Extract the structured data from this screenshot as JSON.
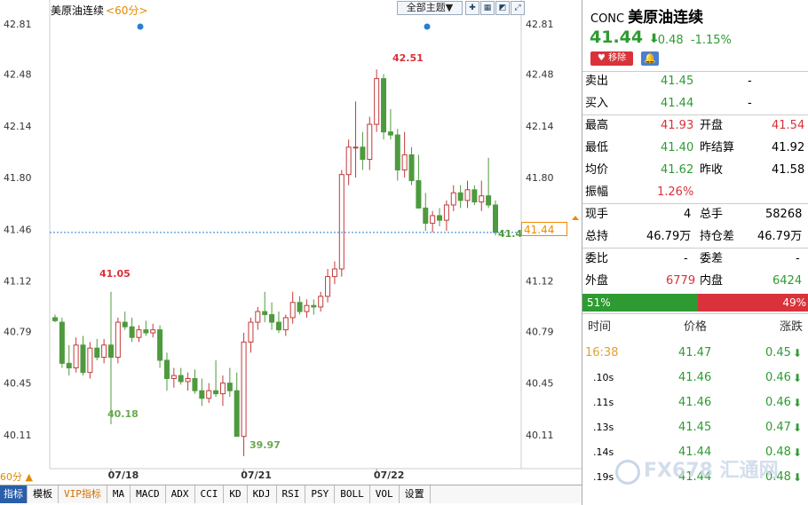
{
  "chart": {
    "title": "美原油连续",
    "period": "<60分>",
    "theme_button": "全部主题▼",
    "period_indicator": "60分 ▲",
    "current_price_tag": "41.44",
    "current_price_right_label": "41.4",
    "high_label": "42.51",
    "low_label": "39.97",
    "left_high_label": "41.05",
    "left_low_label": "40.18"
  },
  "chart_data": {
    "type": "candlestick",
    "title": "美原油连续",
    "y_ticks": [
      "42.81",
      "42.48",
      "42.14",
      "41.80",
      "41.46",
      "41.12",
      "40.79",
      "40.45",
      "40.11"
    ],
    "x_ticks": [
      "07/18",
      "07/21",
      "07/22"
    ],
    "ylim": [
      39.9,
      42.85
    ],
    "last_price": 41.44,
    "candles": [
      {
        "o": 40.88,
        "h": 40.9,
        "l": 40.85,
        "c": 40.86
      },
      {
        "o": 40.85,
        "h": 40.88,
        "l": 40.55,
        "c": 40.58
      },
      {
        "o": 40.58,
        "h": 40.7,
        "l": 40.5,
        "c": 40.55
      },
      {
        "o": 40.55,
        "h": 40.75,
        "l": 40.52,
        "c": 40.7
      },
      {
        "o": 40.7,
        "h": 40.76,
        "l": 40.5,
        "c": 40.52
      },
      {
        "o": 40.52,
        "h": 40.72,
        "l": 40.48,
        "c": 40.68
      },
      {
        "o": 40.68,
        "h": 40.74,
        "l": 40.6,
        "c": 40.62
      },
      {
        "o": 40.62,
        "h": 40.74,
        "l": 40.58,
        "c": 40.7
      },
      {
        "o": 40.7,
        "h": 41.05,
        "l": 40.18,
        "c": 40.62
      },
      {
        "o": 40.62,
        "h": 40.88,
        "l": 40.58,
        "c": 40.85
      },
      {
        "o": 40.85,
        "h": 40.92,
        "l": 40.8,
        "c": 40.82
      },
      {
        "o": 40.82,
        "h": 40.88,
        "l": 40.72,
        "c": 40.75
      },
      {
        "o": 40.75,
        "h": 40.83,
        "l": 40.72,
        "c": 40.8
      },
      {
        "o": 40.8,
        "h": 40.86,
        "l": 40.76,
        "c": 40.78
      },
      {
        "o": 40.78,
        "h": 40.84,
        "l": 40.75,
        "c": 40.8
      },
      {
        "o": 40.8,
        "h": 40.83,
        "l": 40.55,
        "c": 40.6
      },
      {
        "o": 40.6,
        "h": 40.65,
        "l": 40.4,
        "c": 40.48
      },
      {
        "o": 40.48,
        "h": 40.55,
        "l": 40.42,
        "c": 40.5
      },
      {
        "o": 40.5,
        "h": 40.55,
        "l": 40.44,
        "c": 40.46
      },
      {
        "o": 40.46,
        "h": 40.52,
        "l": 40.4,
        "c": 40.48
      },
      {
        "o": 40.48,
        "h": 40.54,
        "l": 40.38,
        "c": 40.4
      },
      {
        "o": 40.4,
        "h": 40.48,
        "l": 40.3,
        "c": 40.35
      },
      {
        "o": 40.35,
        "h": 40.45,
        "l": 40.32,
        "c": 40.4
      },
      {
        "o": 40.4,
        "h": 40.6,
        "l": 40.36,
        "c": 40.38
      },
      {
        "o": 40.38,
        "h": 40.5,
        "l": 40.3,
        "c": 40.45
      },
      {
        "o": 40.45,
        "h": 40.55,
        "l": 40.36,
        "c": 40.4
      },
      {
        "o": 40.4,
        "h": 40.52,
        "l": 40.1,
        "c": 40.1
      },
      {
        "o": 40.1,
        "h": 40.78,
        "l": 39.97,
        "c": 40.72
      },
      {
        "o": 40.72,
        "h": 40.88,
        "l": 40.65,
        "c": 40.85
      },
      {
        "o": 40.85,
        "h": 40.95,
        "l": 40.8,
        "c": 40.92
      },
      {
        "o": 40.92,
        "h": 41.05,
        "l": 40.85,
        "c": 40.9
      },
      {
        "o": 40.9,
        "h": 40.98,
        "l": 40.8,
        "c": 40.85
      },
      {
        "o": 40.85,
        "h": 40.92,
        "l": 40.78,
        "c": 40.8
      },
      {
        "o": 40.8,
        "h": 40.9,
        "l": 40.76,
        "c": 40.88
      },
      {
        "o": 40.88,
        "h": 41.05,
        "l": 40.84,
        "c": 40.98
      },
      {
        "o": 40.98,
        "h": 41.02,
        "l": 40.9,
        "c": 40.92
      },
      {
        "o": 40.92,
        "h": 41.0,
        "l": 40.88,
        "c": 40.96
      },
      {
        "o": 40.96,
        "h": 41.0,
        "l": 40.9,
        "c": 40.95
      },
      {
        "o": 40.95,
        "h": 41.05,
        "l": 40.92,
        "c": 41.02
      },
      {
        "o": 41.02,
        "h": 41.2,
        "l": 40.98,
        "c": 41.15
      },
      {
        "o": 41.15,
        "h": 41.25,
        "l": 41.1,
        "c": 41.2
      },
      {
        "o": 41.2,
        "h": 41.85,
        "l": 41.15,
        "c": 41.82
      },
      {
        "o": 41.82,
        "h": 42.05,
        "l": 41.75,
        "c": 42.0
      },
      {
        "o": 42.0,
        "h": 42.3,
        "l": 41.8,
        "c": 42.0
      },
      {
        "o": 42.0,
        "h": 42.1,
        "l": 41.85,
        "c": 41.92
      },
      {
        "o": 41.92,
        "h": 42.2,
        "l": 41.85,
        "c": 42.15
      },
      {
        "o": 42.15,
        "h": 42.51,
        "l": 42.1,
        "c": 42.45
      },
      {
        "o": 42.45,
        "h": 42.48,
        "l": 42.05,
        "c": 42.1
      },
      {
        "o": 42.1,
        "h": 42.25,
        "l": 42.05,
        "c": 42.08
      },
      {
        "o": 42.08,
        "h": 42.12,
        "l": 41.78,
        "c": 41.85
      },
      {
        "o": 41.85,
        "h": 42.1,
        "l": 41.8,
        "c": 41.95
      },
      {
        "o": 41.95,
        "h": 42.0,
        "l": 41.75,
        "c": 41.78
      },
      {
        "o": 41.78,
        "h": 41.95,
        "l": 41.6,
        "c": 41.6
      },
      {
        "o": 41.6,
        "h": 41.7,
        "l": 41.45,
        "c": 41.5
      },
      {
        "o": 41.5,
        "h": 41.58,
        "l": 41.44,
        "c": 41.55
      },
      {
        "o": 41.55,
        "h": 41.6,
        "l": 41.48,
        "c": 41.52
      },
      {
        "o": 41.52,
        "h": 41.65,
        "l": 41.45,
        "c": 41.62
      },
      {
        "o": 41.62,
        "h": 41.75,
        "l": 41.58,
        "c": 41.7
      },
      {
        "o": 41.7,
        "h": 41.75,
        "l": 41.6,
        "c": 41.65
      },
      {
        "o": 41.65,
        "h": 41.78,
        "l": 41.6,
        "c": 41.72
      },
      {
        "o": 41.72,
        "h": 41.75,
        "l": 41.62,
        "c": 41.64
      },
      {
        "o": 41.64,
        "h": 41.78,
        "l": 41.58,
        "c": 41.68
      },
      {
        "o": 41.68,
        "h": 41.93,
        "l": 41.6,
        "c": 41.62
      },
      {
        "o": 41.62,
        "h": 41.65,
        "l": 41.42,
        "c": 41.44
      }
    ]
  },
  "quote": {
    "symbol": "CONC",
    "name": "美原油连续",
    "price": "41.44",
    "arrow": "🡣",
    "change": "-0.48",
    "change_pct": "-1.15%",
    "remove_label": "移除",
    "ask_label": "卖出",
    "ask_value": "41.45",
    "ask_vol": "-",
    "bid_label": "买入",
    "bid_value": "41.44",
    "bid_vol": "-",
    "high_label": "最高",
    "high_value": "41.93",
    "open_label": "开盘",
    "open_value": "41.54",
    "low_label": "最低",
    "low_value": "41.40",
    "prev_settle_label": "昨结算",
    "prev_settle_value": "41.92",
    "avg_label": "均价",
    "avg_value": "41.62",
    "prev_close_label": "昨收",
    "prev_close_value": "41.58",
    "amp_label": "振幅",
    "amp_value": "1.26%",
    "now_vol_label": "现手",
    "now_vol_value": "4",
    "total_vol_label": "总手",
    "total_vol_value": "58268",
    "total_hold_label": "总持",
    "total_hold_value": "46.79万",
    "hold_diff_label": "持仓差",
    "hold_diff_value": "46.79万",
    "bid_ratio_label": "委比",
    "bid_ratio_value": "-",
    "bid_diff_label": "委差",
    "bid_diff_value": "-",
    "outer_label": "外盘",
    "outer_value": "6779",
    "inner_label": "内盘",
    "inner_value": "6424",
    "buy_pct": "51%",
    "sell_pct": "49%",
    "col_time": "时间",
    "col_price": "价格",
    "col_change": "涨跌"
  },
  "ticks": [
    {
      "time": "16:38",
      "price": "41.47",
      "change": "0.45"
    },
    {
      "time": ".10s",
      "price": "41.46",
      "change": "0.46"
    },
    {
      "time": ".11s",
      "price": "41.46",
      "change": "0.46"
    },
    {
      "time": ".13s",
      "price": "41.45",
      "change": "0.47"
    },
    {
      "time": ".14s",
      "price": "41.44",
      "change": "0.48"
    },
    {
      "time": ".19s",
      "price": "41.44",
      "change": "0.48"
    }
  ],
  "toolbar": [
    "指标",
    "模板",
    "VIP指标",
    "MA",
    "MACD",
    "ADX",
    "CCI",
    "KD",
    "KDJ",
    "RSI",
    "PSY",
    "BOLL",
    "VOL",
    "设置"
  ],
  "watermark": "FX678 汇通网",
  "colors": {
    "up": "#d9323a",
    "down": "#4b9b3c",
    "accent": "#f08a00"
  }
}
